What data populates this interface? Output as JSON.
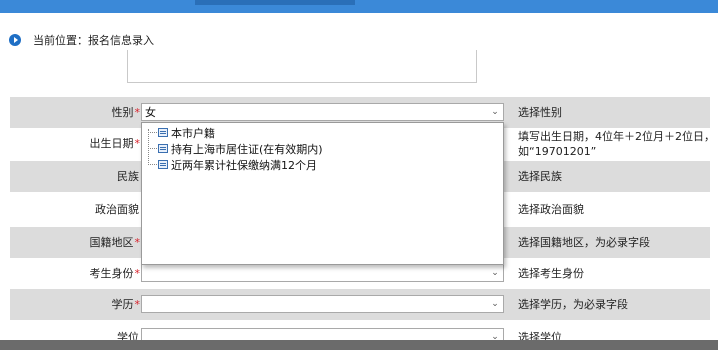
{
  "breadcrumb": {
    "text": "当前位置：报名信息录入"
  },
  "form": {
    "rows": [
      {
        "label": "性别",
        "required": "*",
        "value": "女",
        "hint": "选择性别",
        "hint2": ""
      },
      {
        "label": "出生日期",
        "required": "*",
        "value": "",
        "hint": "填写出生日期，4位年＋2位月＋2位日，",
        "hint2": "如“19701201”"
      },
      {
        "label": "民族",
        "required": "",
        "value": "",
        "hint": "选择民族",
        "hint2": ""
      },
      {
        "label": "政治面貌",
        "required": "",
        "value": "",
        "hint": "选择政治面貌",
        "hint2": ""
      },
      {
        "label": "国籍地区",
        "required": "*",
        "value": "",
        "hint": "选择国籍地区，为必录字段",
        "hint2": ""
      },
      {
        "label": "考生身份",
        "required": "*",
        "value": "",
        "hint": "选择考生身份",
        "hint2": ""
      },
      {
        "label": "学历",
        "required": "*",
        "value": "",
        "hint": "选择学历，为必录字段",
        "hint2": ""
      },
      {
        "label": "学位",
        "required": "",
        "value": "",
        "hint": "选择学位",
        "hint2": ""
      }
    ]
  },
  "dropdown": {
    "options": [
      {
        "label": "本市户籍"
      },
      {
        "label": "持有上海市居住证(在有效期内)"
      },
      {
        "label": "近两年累计社保缴纳满12个月"
      }
    ]
  },
  "colors": {
    "topbar": "#3b89d8",
    "row_shade": "#dcdcdc",
    "required": "#d9202a"
  }
}
